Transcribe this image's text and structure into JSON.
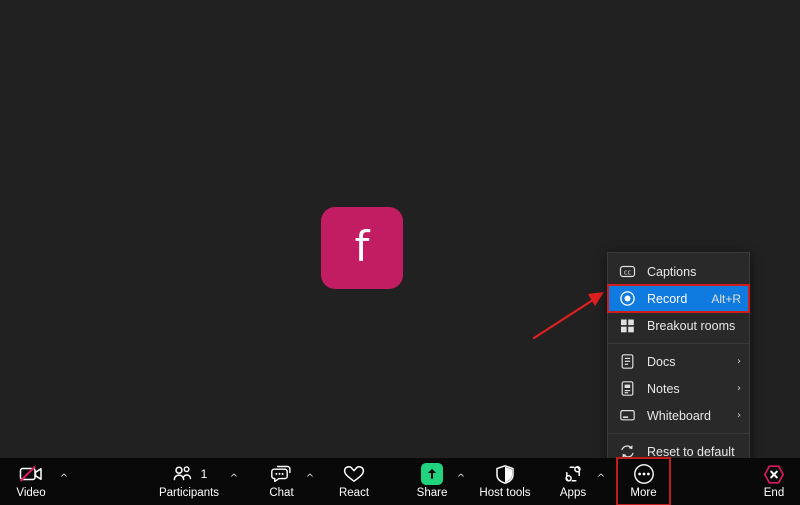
{
  "app": {
    "background_color": "#212121",
    "toolbar_background": "#090909"
  },
  "stage": {
    "avatar": {
      "letter": "f",
      "background_color": "#C21D62",
      "text_color": "#FFFFFF"
    }
  },
  "annotation": {
    "arrow_color": "#E02020",
    "highlight_color": "#C01C1C"
  },
  "more_menu": {
    "background_color": "#292929",
    "selected_background": "#0F7AE0",
    "items": [
      {
        "label": "Captions",
        "icon": "captions-icon",
        "accel": "",
        "chevron": "",
        "selected": false,
        "separator_after": false
      },
      {
        "label": "Record",
        "icon": "record-icon",
        "accel": "Alt+R",
        "chevron": "",
        "selected": true,
        "separator_after": false
      },
      {
        "label": "Breakout rooms",
        "icon": "grid-icon",
        "accel": "",
        "chevron": "",
        "selected": false,
        "separator_after": true
      },
      {
        "label": "Docs",
        "icon": "document-icon",
        "accel": "",
        "chevron": "›",
        "selected": false,
        "separator_after": false
      },
      {
        "label": "Notes",
        "icon": "notes-icon",
        "accel": "",
        "chevron": "›",
        "selected": false,
        "separator_after": false
      },
      {
        "label": "Whiteboard",
        "icon": "whiteboard-icon",
        "accel": "",
        "chevron": "›",
        "selected": false,
        "separator_after": true
      },
      {
        "label": "Reset to default",
        "icon": "reset-icon",
        "accel": "",
        "chevron": "",
        "selected": false,
        "separator_after": false
      }
    ]
  },
  "toolbar": {
    "caret_glyph": "^",
    "buttons": [
      {
        "label": "Video",
        "icon": "camera-off-icon",
        "count": "",
        "has_caret": true
      },
      {
        "label": "Participants",
        "icon": "people-icon",
        "count": "1",
        "has_caret": true
      },
      {
        "label": "Chat",
        "icon": "chat-icon",
        "count": "",
        "has_caret": true
      },
      {
        "label": "React",
        "icon": "heart-icon",
        "count": "",
        "has_caret": false
      },
      {
        "label": "Share",
        "icon": "share-up-icon",
        "count": "",
        "has_caret": true
      },
      {
        "label": "Host tools",
        "icon": "shield-icon",
        "count": "",
        "has_caret": false
      },
      {
        "label": "Apps",
        "icon": "apps-icon",
        "count": "",
        "has_caret": true
      },
      {
        "label": "More",
        "icon": "ellipsis-icon",
        "count": "",
        "has_caret": false
      },
      {
        "label": "End",
        "icon": "end-call-icon",
        "count": "",
        "has_caret": false
      }
    ]
  }
}
